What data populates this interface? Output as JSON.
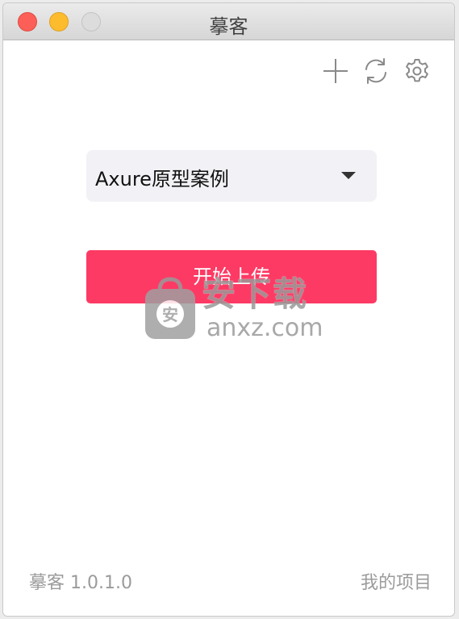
{
  "window": {
    "title": "摹客"
  },
  "toolbar": {
    "icons": [
      "add-icon",
      "refresh-icon",
      "gear-icon"
    ]
  },
  "project_select": {
    "selected": "Axure原型案例"
  },
  "upload_button": {
    "label": "开始上传",
    "color": "#fd3a64"
  },
  "watermark": {
    "logo_text": "安下载",
    "domain": "anxz.com"
  },
  "footer": {
    "version": "摹客 1.0.1.0",
    "my_projects": "我的项目"
  }
}
